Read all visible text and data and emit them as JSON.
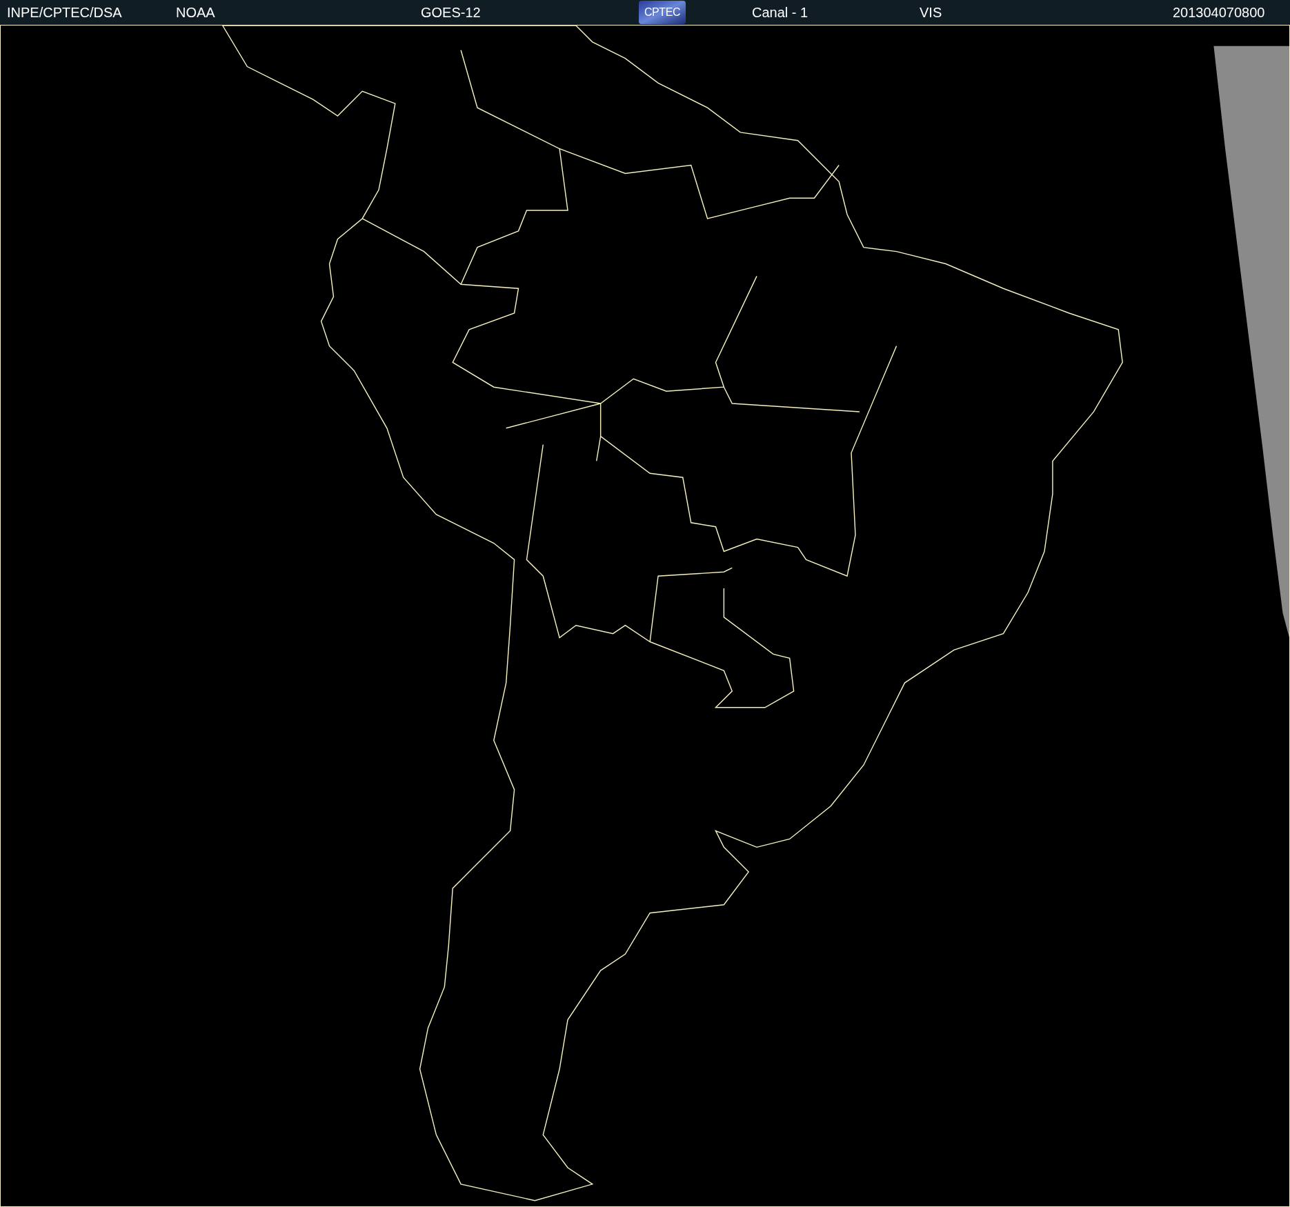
{
  "header": {
    "items": [
      {
        "kind": "text",
        "text": "INPE/CPTEC/DSA"
      },
      {
        "kind": "text",
        "text": "NOAA"
      },
      {
        "kind": "text",
        "text": "GOES-12"
      },
      {
        "kind": "logo",
        "text": "CPTEC"
      },
      {
        "kind": "text",
        "text": "Canal - 1"
      },
      {
        "kind": "text",
        "text": "VIS"
      },
      {
        "kind": "text",
        "text": "201304070800"
      }
    ]
  }
}
